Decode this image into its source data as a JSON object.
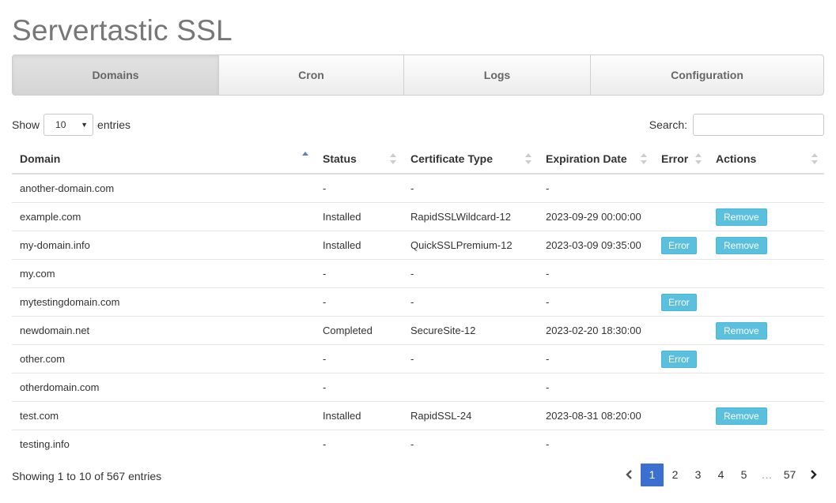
{
  "app": {
    "title": "Servertastic SSL"
  },
  "tabs": [
    {
      "label": "Domains",
      "active": true
    },
    {
      "label": "Cron",
      "active": false
    },
    {
      "label": "Logs",
      "active": false
    },
    {
      "label": "Configuration",
      "active": false
    }
  ],
  "length_control": {
    "prefix": "Show",
    "selected": "10",
    "suffix": "entries"
  },
  "search": {
    "label": "Search:",
    "value": ""
  },
  "table": {
    "columns": [
      "Domain",
      "Status",
      "Certificate Type",
      "Expiration Date",
      "Error",
      "Actions"
    ],
    "sorted_column": "Domain",
    "sort_direction": "asc",
    "rows": [
      {
        "domain": "another-domain.com",
        "status": "-",
        "cert": "-",
        "expires": "-",
        "error": "",
        "action": ""
      },
      {
        "domain": "example.com",
        "status": "Installed",
        "cert": "RapidSSLWildcard-12",
        "expires": "2023-09-29 00:00:00",
        "error": "",
        "action": "Remove"
      },
      {
        "domain": "my-domain.info",
        "status": "Installed",
        "cert": "QuickSSLPremium-12",
        "expires": "2023-03-09 09:35:00",
        "error": "Error",
        "action": "Remove"
      },
      {
        "domain": "my.com",
        "status": "-",
        "cert": "-",
        "expires": "-",
        "error": "",
        "action": ""
      },
      {
        "domain": "mytestingdomain.com",
        "status": "-",
        "cert": "-",
        "expires": "-",
        "error": "Error",
        "action": ""
      },
      {
        "domain": "newdomain.net",
        "status": "Completed",
        "cert": "SecureSite-12",
        "expires": "2023-02-20 18:30:00",
        "error": "",
        "action": "Remove"
      },
      {
        "domain": "other.com",
        "status": "-",
        "cert": "-",
        "expires": "-",
        "error": "Error",
        "action": ""
      },
      {
        "domain": "otherdomain.com",
        "status": "-",
        "cert": "",
        "expires": "-",
        "error": "",
        "action": ""
      },
      {
        "domain": "test.com",
        "status": "Installed",
        "cert": "RapidSSL-24",
        "expires": "2023-08-31 08:20:00",
        "error": "",
        "action": "Remove"
      },
      {
        "domain": "testing.info",
        "status": "-",
        "cert": "-",
        "expires": "-",
        "error": "",
        "action": ""
      }
    ]
  },
  "footer": {
    "info": "Showing 1 to 10 of 567 entries",
    "pages": [
      "1",
      "2",
      "3",
      "4",
      "5",
      "…",
      "57"
    ],
    "current_page": "1"
  },
  "colors": {
    "accent": "#3b6fd0",
    "badge": "#5bc0de",
    "title": "#777777"
  }
}
